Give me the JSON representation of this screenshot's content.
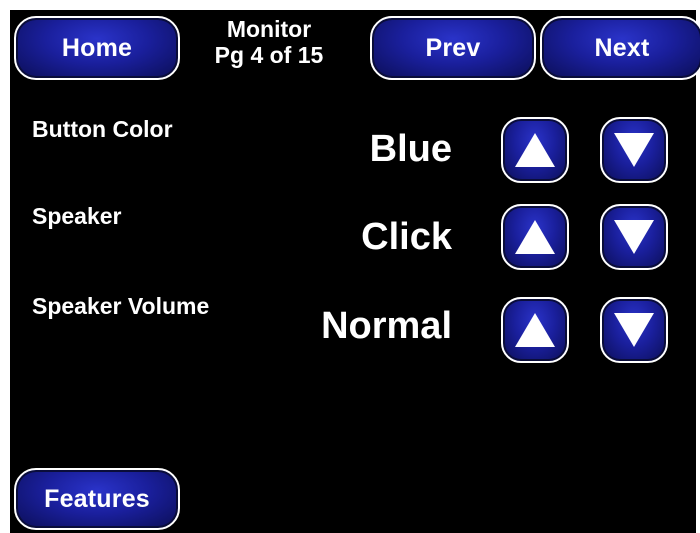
{
  "header": {
    "home_label": "Home",
    "title_line1": "Monitor",
    "title_line2": "Pg 4 of 15",
    "prev_label": "Prev",
    "next_label": "Next"
  },
  "settings": [
    {
      "label": "Button Color",
      "value": "Blue",
      "up_icon": "triangle-up-icon",
      "down_icon": "triangle-down-icon"
    },
    {
      "label": "Speaker",
      "value": "Click",
      "up_icon": "triangle-up-icon",
      "down_icon": "triangle-down-icon"
    },
    {
      "label": "Speaker Volume",
      "value": "Normal",
      "up_icon": "triangle-up-icon",
      "down_icon": "triangle-down-icon"
    }
  ],
  "footer": {
    "features_label": "Features"
  },
  "colors": {
    "background": "#000000",
    "button_fill": "#1a1f9c",
    "button_border": "#ffffff",
    "text": "#ffffff"
  }
}
